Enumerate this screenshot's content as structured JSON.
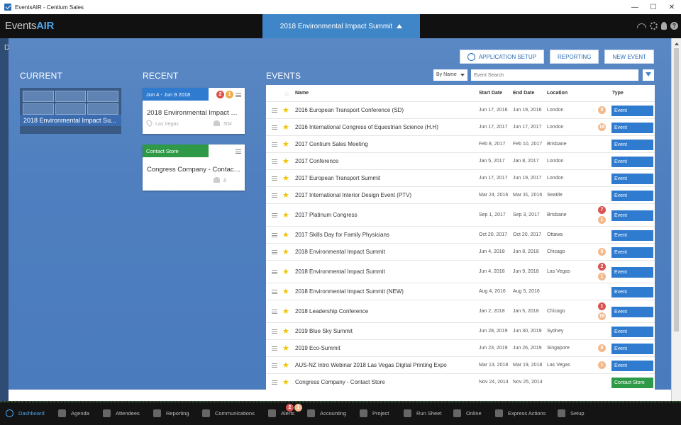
{
  "window": {
    "title": "EventsAIR - Centium Sales",
    "minimize": "—",
    "maximize": "☐",
    "close": "✕"
  },
  "appbar": {
    "logo_prefix": "Events",
    "logo_suffix": "AIR",
    "current_event": "2018 Environmental Impact Summit",
    "help": "?"
  },
  "left_strip_letter": "D",
  "toolbar": {
    "application_setup": "APPLICATION SETUP",
    "reporting": "REPORTING",
    "new_event": "NEW EVENT"
  },
  "sections": {
    "current": "CURRENT",
    "recent": "RECENT",
    "events": "EVENTS"
  },
  "current_card": {
    "label": "2018 Environmental Impact Su..."
  },
  "recent": [
    {
      "date": "Jun 4 - Jun 9 2018",
      "name": "2018 Environmental Impact Su...",
      "location": "Las Vegas",
      "count": "504",
      "badges": [
        "2",
        "1"
      ],
      "header_color": "#2f7bd0"
    },
    {
      "date": "Contact Store",
      "name": "Congress Company - Contact St...",
      "location": "",
      "count": "8",
      "badges": [],
      "header_color": "#2e9a47"
    }
  ],
  "events_filter": {
    "sort": "By Name",
    "search_placeholder": "Event Search"
  },
  "table": {
    "columns": {
      "name": "Name",
      "start": "Start Date",
      "end": "End Date",
      "location": "Location",
      "type": "Type"
    },
    "rows": [
      {
        "name": "2016 European Transport Conference (SD)",
        "start": "Jun 17, 2016",
        "end": "Jun 19, 2016",
        "location": "London",
        "badges": [
          {
            "t": "8",
            "c": "b-peach"
          }
        ],
        "type": "Event"
      },
      {
        "name": "2016 International Congress of Equestrian Science (H.H)",
        "start": "Jun 17, 2017",
        "end": "Jun 17, 2017",
        "location": "London",
        "badges": [
          {
            "t": "16",
            "c": "b-peach"
          }
        ],
        "type": "Event"
      },
      {
        "name": "2017 Centium Sales Meeting",
        "start": "Feb 8, 2017",
        "end": "Feb 10, 2017",
        "location": "Brisbane",
        "badges": [],
        "type": "Event"
      },
      {
        "name": "2017 Conference",
        "start": "Jan 5, 2017",
        "end": "Jan 8, 2017",
        "location": "London",
        "badges": [],
        "type": "Event"
      },
      {
        "name": "2017 European Transport Summit",
        "start": "Jun 17, 2017",
        "end": "Jun 19, 2017",
        "location": "London",
        "badges": [],
        "type": "Event"
      },
      {
        "name": "2017 International Interior Design Event (PTV)",
        "start": "Mar 24, 2016",
        "end": "Mar 31, 2016",
        "location": "Seattle",
        "badges": [],
        "type": "Event"
      },
      {
        "name": "2017 Platinum Congress",
        "start": "Sep 1, 2017",
        "end": "Sep 3, 2017",
        "location": "Brisbane",
        "badges": [
          {
            "t": "7",
            "c": "b-red"
          },
          {
            "t": "1",
            "c": "b-peach"
          }
        ],
        "type": "Event"
      },
      {
        "name": "2017 Skills Day for Family Physicians",
        "start": "Oct 20, 2017",
        "end": "Oct 20, 2017",
        "location": "Ottawa",
        "badges": [],
        "type": "Event"
      },
      {
        "name": "2018 Environmental Impact Summit",
        "start": "Jun 4, 2018",
        "end": "Jun 8, 2018",
        "location": "Chicago",
        "badges": [
          {
            "t": "8",
            "c": "b-peach"
          }
        ],
        "type": "Event"
      },
      {
        "name": "2018 Environmental Impact Summit",
        "start": "Jun 4, 2018",
        "end": "Jun 9, 2018",
        "location": "Las Vegas",
        "badges": [
          {
            "t": "2",
            "c": "b-red"
          },
          {
            "t": "1",
            "c": "b-peach"
          }
        ],
        "type": "Event"
      },
      {
        "name": "2018 Environmental Impact Summit (NEW)",
        "start": "Aug 4, 2016",
        "end": "Aug 5, 2016",
        "location": "",
        "badges": [],
        "type": "Event"
      },
      {
        "name": "2018 Leadership Conference",
        "start": "Jan 2, 2018",
        "end": "Jan 5, 2018",
        "location": "Chicago",
        "badges": [
          {
            "t": "1",
            "c": "b-red"
          },
          {
            "t": "16",
            "c": "b-peach"
          }
        ],
        "type": "Event"
      },
      {
        "name": "2019 Blue Sky Summit",
        "start": "Jun 28, 2019",
        "end": "Jun 30, 2019",
        "location": "Sydney",
        "badges": [],
        "type": "Event"
      },
      {
        "name": "2019 Eco-Summit",
        "start": "Jun 23, 2019",
        "end": "Jun 26, 2019",
        "location": "Singapore",
        "badges": [
          {
            "t": "8",
            "c": "b-peach"
          }
        ],
        "type": "Event"
      },
      {
        "name": "AUS-NZ Intro Webinar 2018 Las Vegas Digital Printing Expo",
        "start": "Mar 13, 2018",
        "end": "Mar 19, 2018",
        "location": "Las Vegas",
        "badges": [
          {
            "t": "1",
            "c": "b-peach"
          }
        ],
        "type": "Event"
      },
      {
        "name": "Congress Company - Contact Store",
        "start": "Nov 24, 2014",
        "end": "Nov 25, 2014",
        "location": "",
        "badges": [],
        "type": "Contact Store"
      }
    ]
  },
  "bottom_nav": {
    "items": [
      "Dashboard",
      "Agenda",
      "Attendees",
      "Reporting",
      "Communications",
      "Alerts",
      "Accounting",
      "Project",
      "Run Sheet",
      "Online",
      "Express Actions",
      "Setup"
    ],
    "alert_badges": [
      "2",
      "1"
    ]
  }
}
